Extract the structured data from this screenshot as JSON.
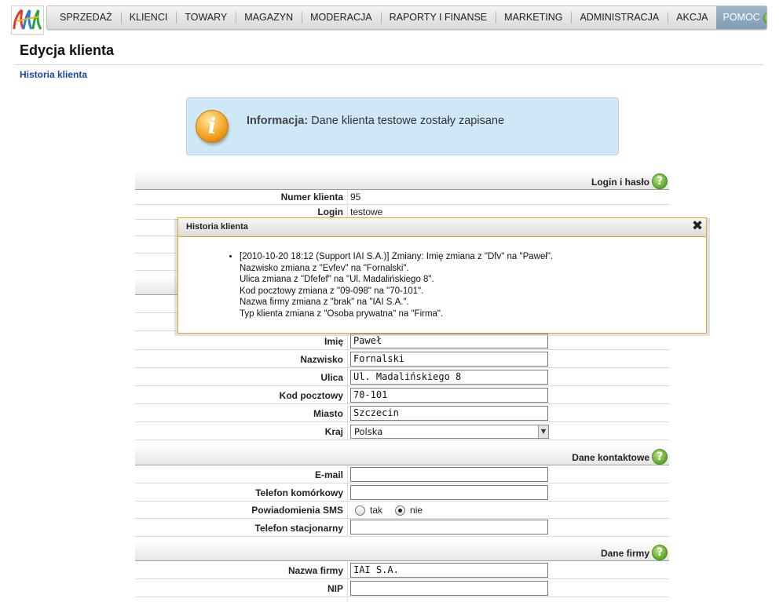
{
  "nav": {
    "items": [
      "SPRZEDAŻ",
      "KLIENCI",
      "TOWARY",
      "MAGAZYN",
      "MODERACJA",
      "RAPORTY I FINANSE",
      "MARKETING",
      "ADMINISTRACJA",
      "AKCJA"
    ],
    "help": "POMOC"
  },
  "page": {
    "title": "Edycja klienta",
    "history_link": "Historia klienta"
  },
  "info": {
    "label": "Informacja:",
    "message": "Dane klienta testowe zostały zapisane"
  },
  "sections": {
    "login": "Login i hasło",
    "contact": "Dane kontaktowe",
    "company": "Dane firmy"
  },
  "login_rows": [
    {
      "label": "Numer klienta",
      "value": "95"
    },
    {
      "label": "Login",
      "value": "testowe"
    }
  ],
  "address_rows": [
    {
      "label": "Imię",
      "value": "Paweł"
    },
    {
      "label": "Nazwisko",
      "value": "Fornalski"
    },
    {
      "label": "Ulica",
      "value": "Ul. Madalińskiego 8"
    },
    {
      "label": "Kod pocztowy",
      "value": "70-101"
    },
    {
      "label": "Miasto",
      "value": "Szczecin"
    }
  ],
  "country": {
    "label": "Kraj",
    "value": "Polska"
  },
  "contact_rows": {
    "email": {
      "label": "E-mail",
      "value": ""
    },
    "mobile": {
      "label": "Telefon komórkowy",
      "value": ""
    },
    "sms": {
      "label": "Powiadomienia SMS",
      "yes": "tak",
      "no": "nie",
      "selected": "nie"
    },
    "phone": {
      "label": "Telefon stacjonarny",
      "value": ""
    }
  },
  "company_rows": {
    "name": {
      "label": "Nazwa firmy",
      "value": "IAI S.A."
    },
    "nip": {
      "label": "NIP",
      "value": ""
    }
  },
  "modal": {
    "title": "Historia klienta",
    "lines": [
      "[2010-10-20 18:12 (Support IAI S.A.)] Zmiany: Imię zmiana z \"Dfv\" na \"Paweł\".",
      "Nazwisko zmiana z \"Evfev\" na \"Fornalski\".",
      "Ulica zmiana z \"Dfefef\" na \"Ul. Madalińskiego 8\".",
      "Kod pocztowy zmiana z \"09-098\" na \"70-101\".",
      "Nazwa firmy zmiana z \"brak\" na \"IAI S.A.\".",
      "Typ klienta zmiana z \"Osoba prywatna\" na \"Firma\"."
    ]
  }
}
